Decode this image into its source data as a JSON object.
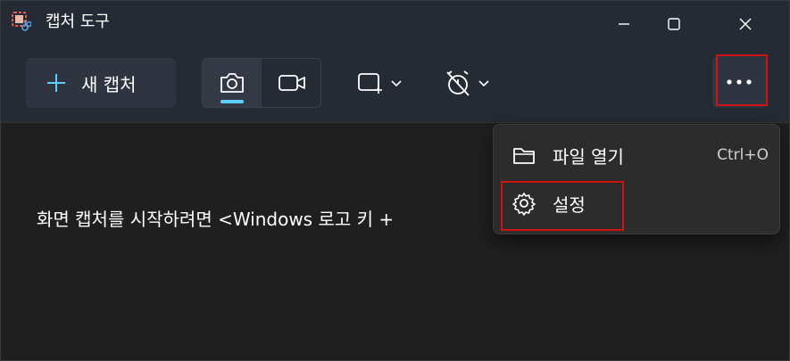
{
  "window": {
    "title": "캡처 도구"
  },
  "toolbar": {
    "new_capture_label": "새 캡처",
    "modes": [
      {
        "name": "screenshot",
        "icon": "camera-icon",
        "active": true
      },
      {
        "name": "video",
        "icon": "video-camera-icon",
        "active": false
      }
    ],
    "shape_icon": "rectangle-snip-icon",
    "timer_icon": "timer-off-icon",
    "more_icon": "more-dots-icon"
  },
  "content": {
    "hint_text": "화면 캡처를 시작하려면 <Windows 로고 키 +"
  },
  "menu": {
    "items": [
      {
        "label": "파일 열기",
        "shortcut": "Ctrl+O",
        "icon": "folder-icon"
      },
      {
        "label": "설정",
        "shortcut": "",
        "icon": "gear-icon"
      }
    ]
  },
  "colors": {
    "accent": "#60cdff",
    "highlight": "#d01414",
    "titlebar": "#252b35",
    "menu_bg": "#2c2c2c"
  }
}
